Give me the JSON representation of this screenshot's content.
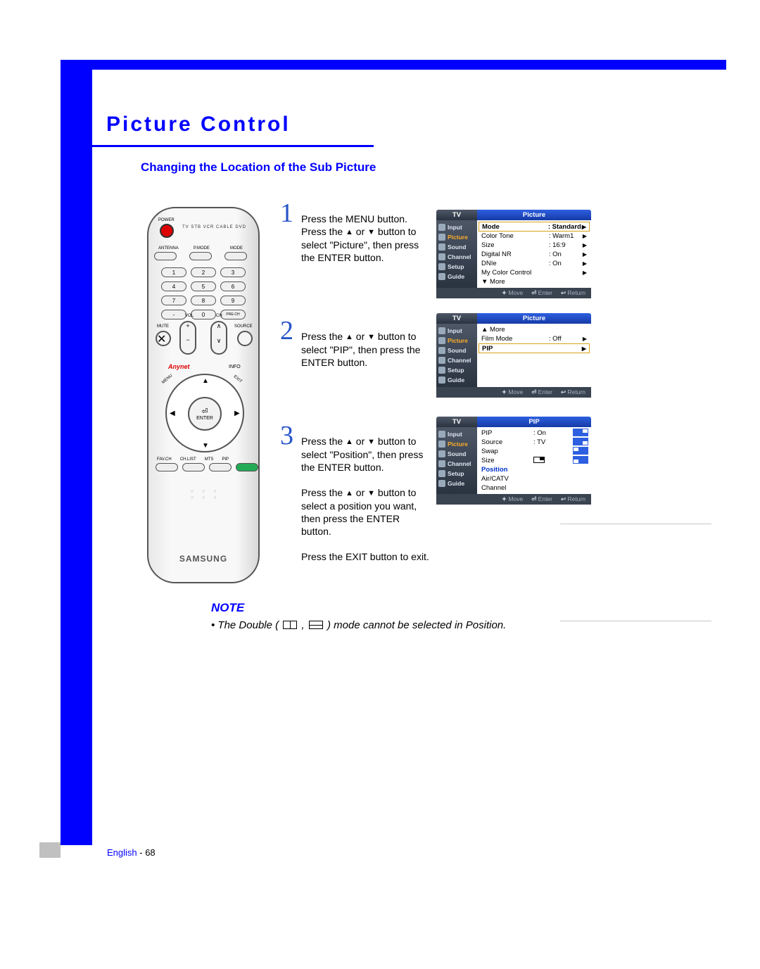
{
  "page": {
    "section_title": "Picture Control",
    "subheading": "Changing the Location of the Sub Picture",
    "footer_lang": "English",
    "footer_sep": " - ",
    "footer_page": "68"
  },
  "remote": {
    "brand": "SAMSUNG",
    "labels": {
      "power": "POWER",
      "top_modes": "TV  STB  VCR  CABLE  DVD",
      "antenna": "ANTENNA",
      "pmode": "P.MODE",
      "mode": "MODE",
      "mute": "MUTE",
      "vol": "VOL",
      "ch": "CH",
      "source": "SOURCE",
      "prech": "PRE-CH",
      "anynet": "Anynet",
      "info": "INFO",
      "menu": "MENU",
      "exit": "EXIT",
      "enter": "ENTER",
      "favch": "FAV.CH",
      "chlist": "CH.LIST",
      "mts": "MTS",
      "pip": "PIP"
    },
    "numpad": [
      "1",
      "2",
      "3",
      "4",
      "5",
      "6",
      "7",
      "8",
      "9",
      "-",
      "0",
      "PRE-CH"
    ]
  },
  "steps": [
    {
      "num": "1",
      "text_before": "Press the MENU button.\nPress the ",
      "text_mid": " or ",
      "text_after": " button to select \"Picture\", then press the ENTER button."
    },
    {
      "num": "2",
      "text_before": "Press the ",
      "text_mid": " or ",
      "text_after": " button to select \"PIP\", then press the ENTER button."
    },
    {
      "num": "3",
      "text_before": "Press the ",
      "text_mid": " or ",
      "text_after": " button to select \"Position\", then press the ENTER button.",
      "text_before2": "Press the ",
      "text_mid2": " or ",
      "text_after2": " button to select a position you want, then press the ENTER button.",
      "exit": "Press the EXIT button to exit."
    }
  ],
  "menus": {
    "sidebar": [
      "Input",
      "Picture",
      "Sound",
      "Channel",
      "Setup",
      "Guide"
    ],
    "foot": {
      "move": "Move",
      "enter": "Enter",
      "return": "Return"
    },
    "tv": "TV",
    "m1": {
      "title": "Picture",
      "active": 1,
      "rows": [
        {
          "k": "Mode",
          "v": ": Standard",
          "sel": true
        },
        {
          "k": "Color Tone",
          "v": ": Warm1"
        },
        {
          "k": "Size",
          "v": ": 16:9"
        },
        {
          "k": "Digital NR",
          "v": ": On"
        },
        {
          "k": "DNIe",
          "v": ": On"
        },
        {
          "k": "My Color Control",
          "v": ""
        },
        {
          "k": "▼ More",
          "v": "",
          "noarrow": true
        }
      ]
    },
    "m2": {
      "title": "Picture",
      "active": 1,
      "rows": [
        {
          "k": "▲ More",
          "v": "",
          "noarrow": true
        },
        {
          "k": "Film Mode",
          "v": ": Off"
        },
        {
          "k": "PIP",
          "v": "",
          "sel": true
        }
      ]
    },
    "m3": {
      "title": "PIP",
      "active": 1,
      "rows": [
        {
          "k": "PIP",
          "v": ": On",
          "noarrow": true
        },
        {
          "k": "Source",
          "v": ": TV",
          "noarrow": true
        },
        {
          "k": "Swap",
          "v": "",
          "noarrow": true
        },
        {
          "k": "Size",
          "v": "",
          "noarrow": true,
          "sizeicon": true
        },
        {
          "k": "Position",
          "v": "",
          "hl": true,
          "noarrow": true,
          "posgrid": true
        },
        {
          "k": "Air/CATV",
          "v": "",
          "noarrow": true
        },
        {
          "k": "Channel",
          "v": "",
          "noarrow": true
        }
      ]
    }
  },
  "note": {
    "title": "NOTE",
    "text_before": "• The Double ( ",
    "text_mid": " , ",
    "text_after": " ) mode cannot be selected in Position."
  }
}
